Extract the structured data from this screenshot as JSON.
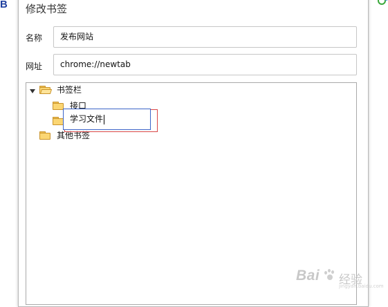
{
  "background": {
    "left_glyph": "B"
  },
  "dialog": {
    "title": "修改书签",
    "name_label": "名称",
    "name_value": "发布网站",
    "url_label": "网址",
    "url_value": "chrome://newtab"
  },
  "tree": {
    "root": {
      "label": "书签栏",
      "expanded": true
    },
    "children": [
      {
        "label": "接口"
      },
      {
        "label": "学习文件",
        "editing": true
      }
    ],
    "other": {
      "label": "其他书签"
    }
  },
  "rename_field": {
    "value": "学习文件"
  },
  "watermark": {
    "brand": "Bai",
    "text": "经验",
    "sub": "jingyan.baidu.com"
  },
  "colors": {
    "folder_fill": "#fbd673",
    "folder_border": "#c9932a",
    "edit_border": "#3a63c8",
    "highlight_border": "#d94646",
    "accent_left": "#1f3fa0"
  }
}
